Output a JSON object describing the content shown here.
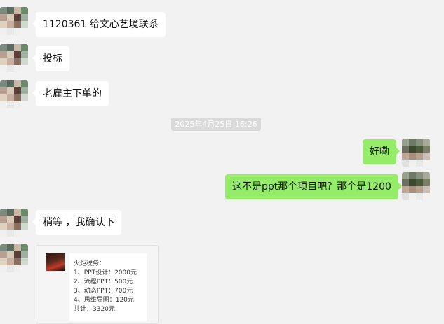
{
  "messages": [
    {
      "side": "left",
      "text": "1120361  给文心艺境联系"
    },
    {
      "side": "left",
      "text": "投标"
    },
    {
      "side": "left",
      "text": "老雇主下单的"
    },
    {
      "side": "right",
      "text": "好嘞"
    },
    {
      "side": "right",
      "text": "这不是ppt那个项目吧？那个是1200"
    },
    {
      "side": "left",
      "text": "稍等 ，我确认下"
    }
  ],
  "timestamp": "2025年4月25日 16:26",
  "image_message": {
    "lines": [
      "火炬税务：",
      "1、PPT设计：2000元",
      "2、流程PPT：500元",
      "3、动态PPT：700元",
      "4、思维导图：120元",
      "共计：3320元"
    ]
  },
  "colors": {
    "background": "#f2f2f2",
    "bubble_self": "#95ec69",
    "bubble_other": "#ffffff",
    "timestamp_bg": "#dadada"
  }
}
